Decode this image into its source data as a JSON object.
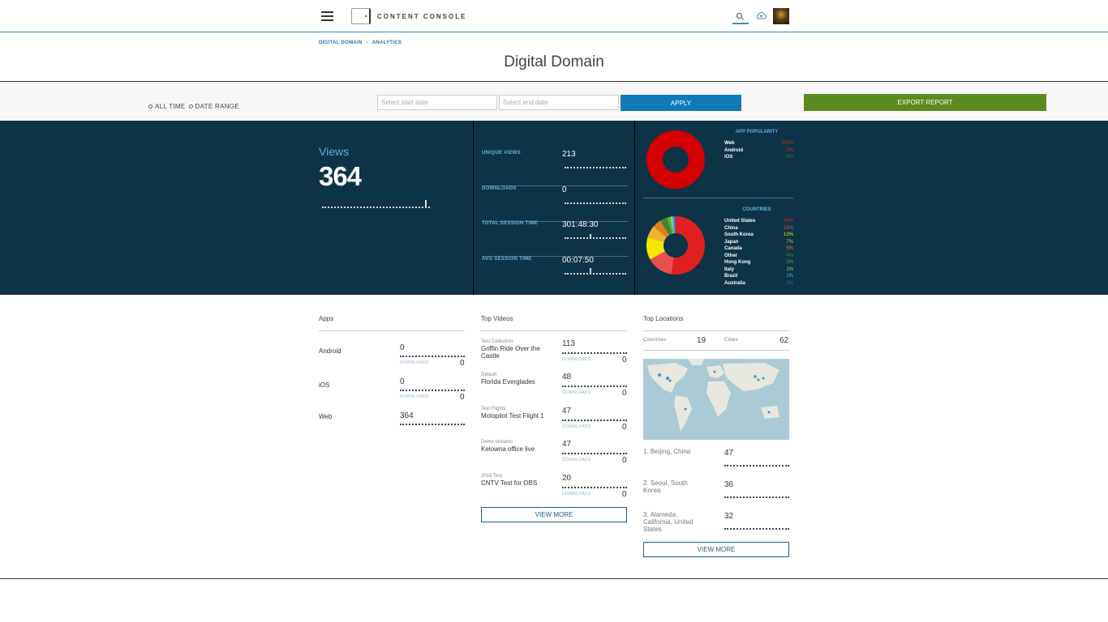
{
  "header": {
    "brand": "CONTENT CONSOLE"
  },
  "breadcrumb": {
    "items": [
      "DIGITAL DOMAIN",
      "ANALYTICS"
    ],
    "separator": "›"
  },
  "page_title": "Digital Domain",
  "filters": {
    "options": [
      "ALL TIME",
      "DATE RANGE"
    ],
    "start_placeholder": "Select start date",
    "end_placeholder": "Select end date",
    "apply_label": "APPLY",
    "export_label": "EXPORT REPORT"
  },
  "stats": {
    "views_label": "Views",
    "views_value": "364",
    "metrics": [
      {
        "label": "UNIQUE VIEWS",
        "value": "213"
      },
      {
        "label": "DOWNLOADS",
        "value": "0"
      },
      {
        "label": "TOTAL SESSION TIME",
        "value": "301:48:30"
      },
      {
        "label": "AVG SESSION TIME",
        "value": "00:07:50"
      }
    ],
    "app_popularity": {
      "title": "APP POPULARITY",
      "items": [
        {
          "name": "Web",
          "pct": "100%",
          "color": "#e02020"
        },
        {
          "name": "Android",
          "pct": "0%",
          "color": "#e02020"
        },
        {
          "name": "iOS",
          "pct": "0%",
          "color": "#3a7a3a"
        }
      ]
    },
    "countries": {
      "title": "COUNTRIES",
      "items": [
        {
          "name": "United States",
          "pct": "54%",
          "color": "#e02020"
        },
        {
          "name": "China",
          "pct": "15%",
          "color": "#e85050"
        },
        {
          "name": "South Korea",
          "pct": "13%",
          "color": "#f5e800"
        },
        {
          "name": "Japan",
          "pct": "7%",
          "color": "#f0b030"
        },
        {
          "name": "Canada",
          "pct": "5%",
          "color": "#e08020"
        },
        {
          "name": "Other",
          "pct": "4%",
          "color": "#3a8a2a"
        },
        {
          "name": "Hong Kong",
          "pct": "2%",
          "color": "#60b040"
        },
        {
          "name": "Italy",
          "pct": "1%",
          "color": "#90e060"
        },
        {
          "name": "Brazil",
          "pct": "1%",
          "color": "#40c0d0"
        },
        {
          "name": "Australia",
          "pct": "1%",
          "color": "#8040e0"
        }
      ]
    }
  },
  "apps": {
    "title": "Apps",
    "downloads_label": "DOWNLOADS",
    "items": [
      {
        "name": "Android",
        "views": "0",
        "downloads": "0"
      },
      {
        "name": "iOS",
        "views": "0",
        "downloads": "0"
      },
      {
        "name": "Web",
        "views": "364"
      }
    ]
  },
  "videos": {
    "title": "Top Videos",
    "downloads_label": "DOWNLOADS",
    "view_more": "VIEW MORE",
    "items": [
      {
        "category": "Test Collection",
        "title": "Griffin Ride Over the Castle",
        "views": "113",
        "downloads": "0"
      },
      {
        "category": "Default",
        "title": "Florida Everglades",
        "views": "48",
        "downloads": "0"
      },
      {
        "category": "Test Flights",
        "title": "Motopilot Test Flight 1",
        "views": "47",
        "downloads": "0"
      },
      {
        "category": "Demo streams",
        "title": "Kelowna office live",
        "views": "47",
        "downloads": "0"
      },
      {
        "category": "2016 Test",
        "title": "CNTV Test for OBS",
        "views": "20",
        "downloads": "0"
      }
    ]
  },
  "locations": {
    "title": "Top Locations",
    "countries_label": "Countries",
    "countries_value": "19",
    "cities_label": "Cities",
    "cities_value": "62",
    "view_more": "VIEW MORE",
    "items": [
      {
        "name": "1. Beijing, China",
        "value": "47"
      },
      {
        "name": "2. Seoul, South Korea",
        "value": "36"
      },
      {
        "name": "3. Alameda, California, United States",
        "value": "32"
      }
    ]
  }
}
